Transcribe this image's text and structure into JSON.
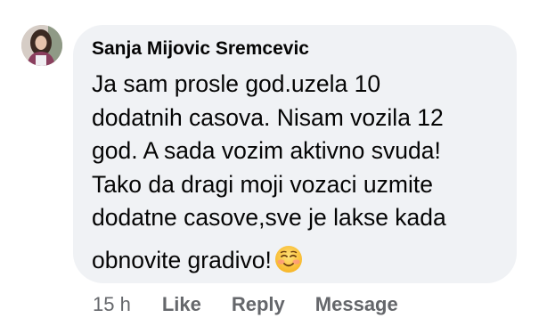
{
  "comment": {
    "author": "Sanja Mijovic Sremcevic",
    "text_lines": [
      "Ja sam prosle god.uzela 10",
      "dodatnih casova. Nisam vozila 12",
      "god. A sada vozim aktivno svuda!",
      "Tako da dragi moji vozaci uzmite",
      "dodatne casove,sve je lakse kada",
      "obnovite gradivo!"
    ],
    "emoji": "smiling-face-icon",
    "timestamp": "15 h",
    "actions": {
      "like": "Like",
      "reply": "Reply",
      "message": "Message"
    }
  },
  "colors": {
    "bubble": "#f0f2f5",
    "text": "#050505",
    "secondary": "#65676b"
  }
}
